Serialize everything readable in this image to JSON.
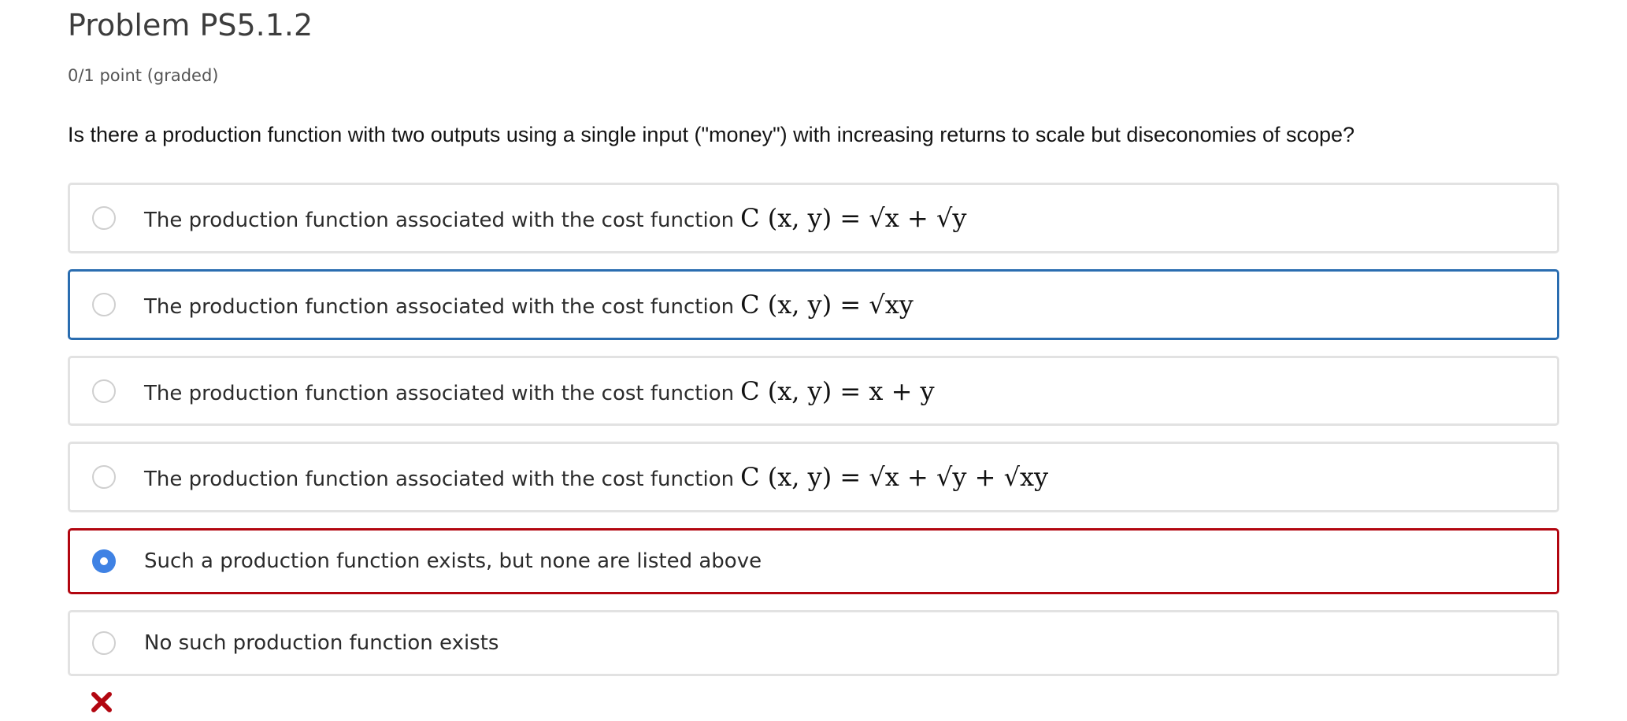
{
  "problem": {
    "title": "Problem PS5.1.2",
    "points": "0/1 point (graded)",
    "question": "Is there a production function with two outputs using a single input (\"money\") with increasing returns to scale but diseconomies of scope?"
  },
  "options": [
    {
      "label": "The production function associated with the cost function",
      "math": "C (x, y) = √x + √y",
      "selected": false
    },
    {
      "label": "The production function associated with the cost function",
      "math": "C (x, y) = √xy",
      "selected": false
    },
    {
      "label": "The production function associated with the cost function",
      "math": "C (x, y) = x + y",
      "selected": false
    },
    {
      "label": "The production function associated with the cost function",
      "math": "C (x, y) = √x + √y + √xy",
      "selected": false
    },
    {
      "label": "Such a production function exists, but none are listed above",
      "math": "",
      "selected": true
    },
    {
      "label": "No such production function exists",
      "math": "",
      "selected": false
    }
  ],
  "result": {
    "icon": "incorrect-x-icon",
    "color": "#b20610"
  },
  "colors": {
    "hover_border": "#2a6db0",
    "incorrect_border": "#b20610",
    "radio_selected": "#3f82e4"
  }
}
